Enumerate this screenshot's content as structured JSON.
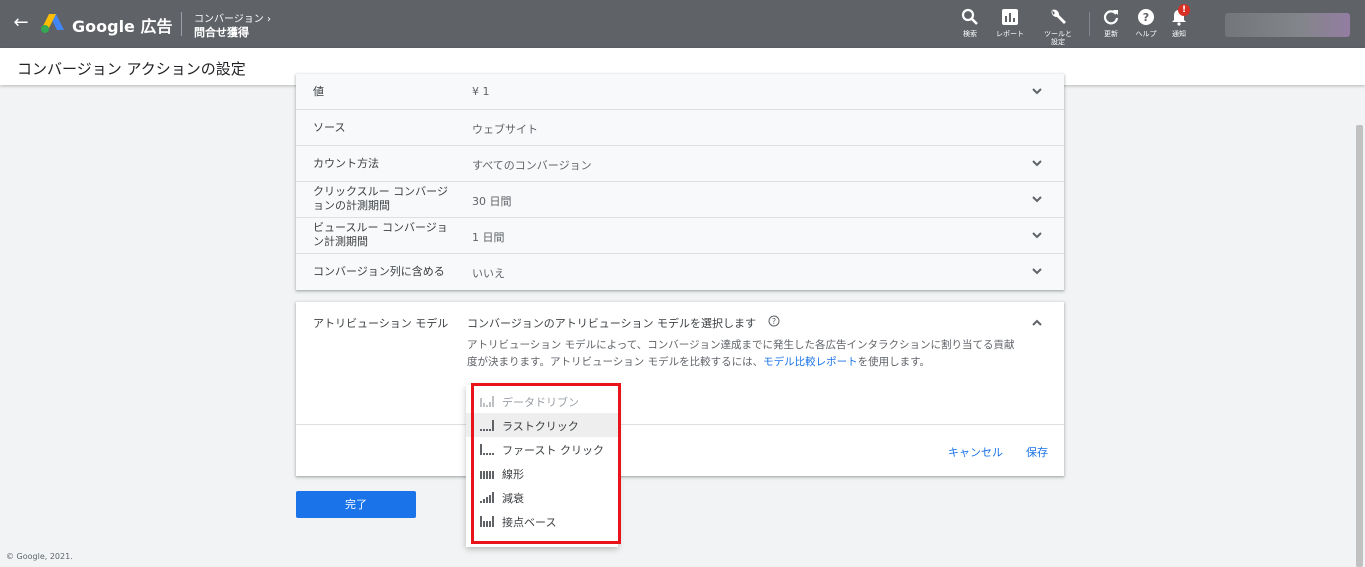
{
  "topbar": {
    "brand": "Google 広告",
    "breadcrumb_parent": "コンバージョン",
    "breadcrumb_current": "問合せ獲得",
    "tools": [
      {
        "label": "検索",
        "icon": "search-icon"
      },
      {
        "label": "レポート",
        "icon": "report-icon"
      },
      {
        "label": "ツールと設定",
        "icon": "wrench-icon"
      },
      {
        "label": "更新",
        "icon": "refresh-icon"
      },
      {
        "label": "ヘルプ",
        "icon": "help-icon"
      },
      {
        "label": "通知",
        "icon": "bell-icon",
        "badge": "!"
      }
    ]
  },
  "subheader": {
    "title": "コンバージョン アクションの設定"
  },
  "settings": [
    {
      "label": "値",
      "value": "¥ 1"
    },
    {
      "label": "ソース",
      "value": "ウェブサイト"
    },
    {
      "label": "カウント方法",
      "value": "すべてのコンバージョン"
    },
    {
      "label": "クリックスルー コンバージョンの計測期間",
      "value": "30 日間"
    },
    {
      "label": "ビュースルー コンバージョン計測期間",
      "value": "1 日間"
    },
    {
      "label": "コンバージョン列に含める",
      "value": "いいえ"
    }
  ],
  "attribution": {
    "label": "アトリビューション モデル",
    "question": "コンバージョンのアトリビューション モデルを選択します",
    "desc_before_link": "アトリビューション モデルによって、コンバージョン達成までに発生した各広告インタラクションに割り当てる貢献度が決まります。アトリビューション モデルを比較するには、",
    "desc_link": "モデル比較レポート",
    "desc_after_link": "を使用します。",
    "cancel": "キャンセル",
    "save": "保存",
    "options": [
      {
        "label": "データドリブン",
        "state": "disabled"
      },
      {
        "label": "ラストクリック",
        "state": "selected"
      },
      {
        "label": "ファースト クリック",
        "state": "normal"
      },
      {
        "label": "線形",
        "state": "normal"
      },
      {
        "label": "減衰",
        "state": "normal"
      },
      {
        "label": "接点ベース",
        "state": "normal"
      }
    ]
  },
  "done_button": "完了",
  "copyright": "© Google, 2021.",
  "colors": {
    "accent": "#1a73e8",
    "highlight": "#e8141a",
    "topbar": "#5f6368"
  }
}
